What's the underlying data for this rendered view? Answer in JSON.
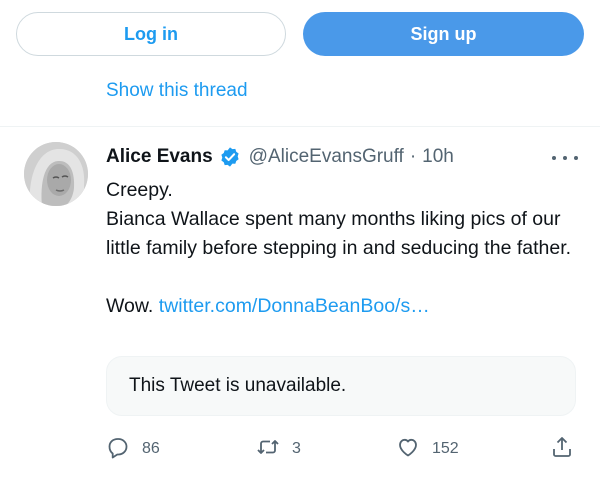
{
  "auth": {
    "login_label": "Log in",
    "signup_label": "Sign up"
  },
  "thread": {
    "show_thread_label": "Show this thread"
  },
  "tweet": {
    "author_name": "Alice Evans",
    "verified": true,
    "handle": "@AliceEvansGruff",
    "separator": "·",
    "time": "10h",
    "text_line1": "Creepy.",
    "text_line2": "Bianca Wallace spent many months liking pics of our little family before stepping in and seducing the father.",
    "text_line3_prefix": "Wow.",
    "link_text": "twitter.com/DonnaBeanBoo/s…",
    "quoted_unavailable": "This Tweet is unavailable."
  },
  "actions": {
    "reply_count": "86",
    "retweet_count": "3",
    "like_count": "152"
  },
  "colors": {
    "accent": "#1d9bf0",
    "signup_bg": "#4a99e9",
    "text_primary": "#0f1419",
    "text_secondary": "#536471"
  },
  "icons": [
    "checkmark-verified-icon",
    "more-icon",
    "reply-icon",
    "retweet-icon",
    "like-icon",
    "share-icon"
  ]
}
